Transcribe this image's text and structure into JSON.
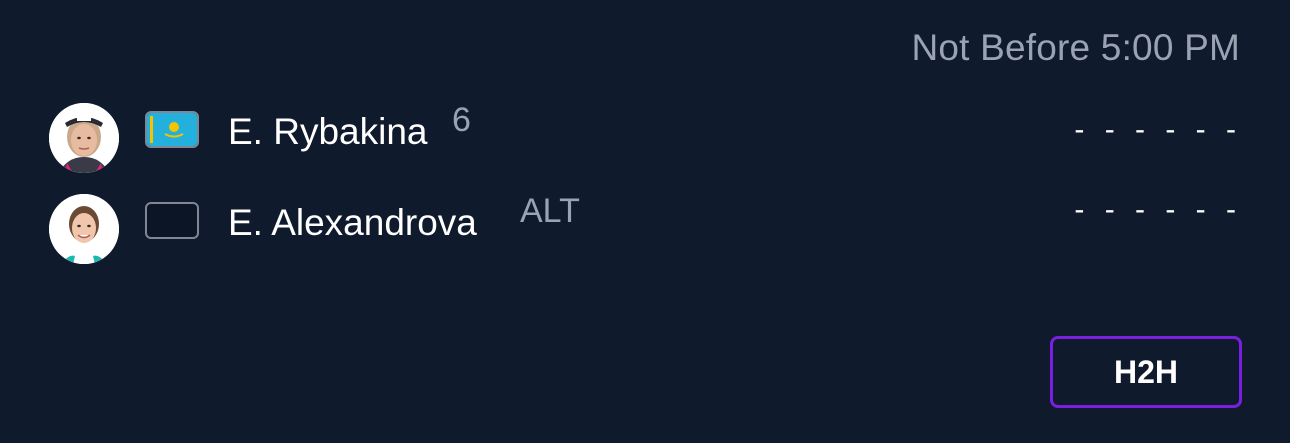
{
  "match": {
    "schedule_text": "Not Before 5:00 PM"
  },
  "players": [
    {
      "name": "E. Rybakina",
      "tag": "6",
      "score": "- - - - - -",
      "flag_icon": "kazakhstan-flag-icon",
      "flag_colors": {
        "field": "#23b0dc",
        "emblem": "#f5c400"
      },
      "avatar_icon": "player-photo-rybakina"
    },
    {
      "name": "E. Alexandrova",
      "tag": "ALT",
      "score": "- - - - - -",
      "flag_icon": "empty-flag-icon",
      "avatar_icon": "player-photo-alexandrova"
    }
  ],
  "actions": {
    "h2h_label": "H2H"
  },
  "colors": {
    "background": "#101a2d",
    "text_primary": "#ffffff",
    "text_secondary": "#9aa3b1",
    "accent": "#7a1fe0"
  }
}
